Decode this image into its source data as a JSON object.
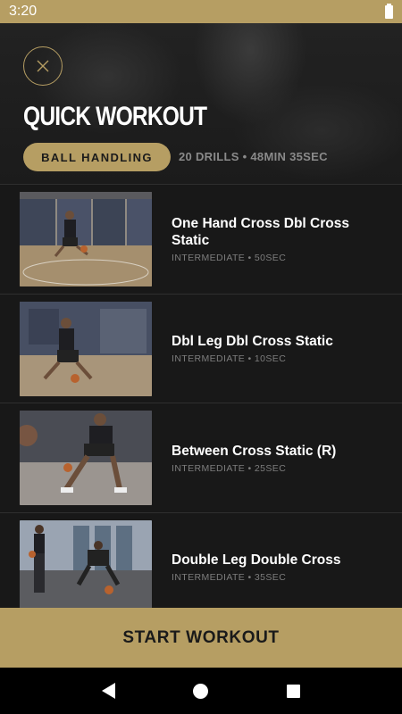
{
  "status_bar": {
    "time": "3:20"
  },
  "header": {
    "title": "QUICK WORKOUT",
    "tag": "BALL HANDLING",
    "summary": "20 DRILLS • 48MIN 35SEC"
  },
  "drills": [
    {
      "name": "One Hand Cross Dbl Cross Static",
      "meta": "INTERMEDIATE • 50SEC"
    },
    {
      "name": "Dbl Leg Dbl Cross Static",
      "meta": "INTERMEDIATE • 10SEC"
    },
    {
      "name": "Between Cross Static (R)",
      "meta": "INTERMEDIATE • 25SEC"
    },
    {
      "name": "Double Leg Double Cross",
      "meta": "INTERMEDIATE • 35SEC"
    }
  ],
  "footer": {
    "start_label": "START WORKOUT"
  },
  "colors": {
    "accent": "#b69e63",
    "background": "#181818"
  },
  "icons": [
    "close-icon",
    "battery-icon",
    "nav-back-icon",
    "nav-home-icon",
    "nav-recents-icon"
  ]
}
